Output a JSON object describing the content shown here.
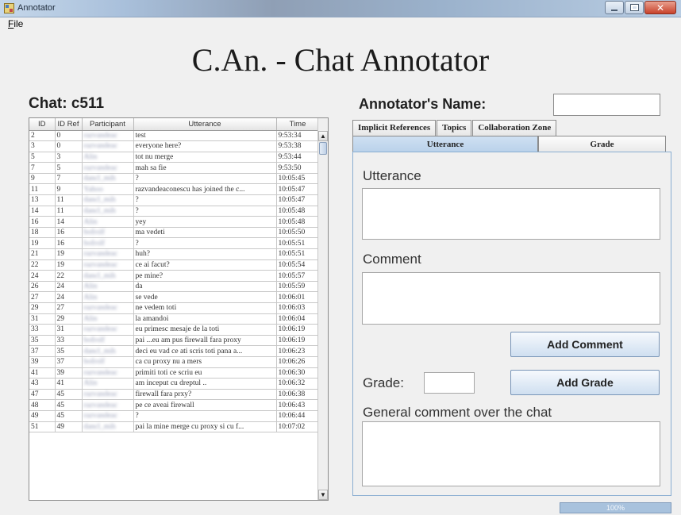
{
  "window": {
    "title": "Annotator",
    "controls": [
      "minimize",
      "maximize",
      "close"
    ]
  },
  "menu": {
    "file_first": "F",
    "file_rest": "ile"
  },
  "app": {
    "title": "C.An. - Chat Annotator"
  },
  "chat": {
    "label": "Chat: c511",
    "columns": [
      "ID",
      "ID Ref",
      "Participant",
      "Utterance",
      "Time"
    ],
    "rows": [
      {
        "id": "2",
        "ref": "0",
        "participant": "razvandeac",
        "utterance": "test",
        "time": "9:53:34"
      },
      {
        "id": "3",
        "ref": "0",
        "participant": "razvandeac",
        "utterance": "everyone here?",
        "time": "9:53:38"
      },
      {
        "id": "5",
        "ref": "3",
        "participant": "Alin",
        "utterance": "tot nu merge",
        "time": "9:53:44"
      },
      {
        "id": "7",
        "ref": "5",
        "participant": "razvandeac",
        "utterance": "mah sa fie",
        "time": "9:53:50"
      },
      {
        "id": "9",
        "ref": "7",
        "participant": "dancl_mih",
        "utterance": "?",
        "time": "10:05:45"
      },
      {
        "id": "11",
        "ref": "9",
        "participant": "Yahoo",
        "utterance": "razvandeaconescu has joined the c...",
        "time": "10:05:47"
      },
      {
        "id": "13",
        "ref": "11",
        "participant": "dancl_mih",
        "utterance": "?",
        "time": "10:05:47"
      },
      {
        "id": "14",
        "ref": "11",
        "participant": "dancl_mih",
        "utterance": "?",
        "time": "10:05:48"
      },
      {
        "id": "16",
        "ref": "14",
        "participant": "Alin",
        "utterance": "yey",
        "time": "10:05:48"
      },
      {
        "id": "18",
        "ref": "16",
        "participant": "bofrolf",
        "utterance": "ma vedeti",
        "time": "10:05:50"
      },
      {
        "id": "19",
        "ref": "16",
        "participant": "bofrolf",
        "utterance": "?",
        "time": "10:05:51"
      },
      {
        "id": "21",
        "ref": "19",
        "participant": "razvandeac",
        "utterance": "huh?",
        "time": "10:05:51"
      },
      {
        "id": "22",
        "ref": "19",
        "participant": "razvandeac",
        "utterance": "ce ai facut?",
        "time": "10:05:54"
      },
      {
        "id": "24",
        "ref": "22",
        "participant": "dancl_mih",
        "utterance": "pe mine?",
        "time": "10:05:57"
      },
      {
        "id": "26",
        "ref": "24",
        "participant": "Alin",
        "utterance": "da",
        "time": "10:05:59"
      },
      {
        "id": "27",
        "ref": "24",
        "participant": "Alin",
        "utterance": "se vede",
        "time": "10:06:01"
      },
      {
        "id": "29",
        "ref": "27",
        "participant": "razvandeac",
        "utterance": "ne vedem toti",
        "time": "10:06:03"
      },
      {
        "id": "31",
        "ref": "29",
        "participant": "Alin",
        "utterance": "la amandoi",
        "time": "10:06:04"
      },
      {
        "id": "33",
        "ref": "31",
        "participant": "razvandeac",
        "utterance": "eu primesc mesaje de la toti",
        "time": "10:06:19"
      },
      {
        "id": "35",
        "ref": "33",
        "participant": "bofrolf",
        "utterance": "pai ...eu am pus firewall fara proxy",
        "time": "10:06:19"
      },
      {
        "id": "37",
        "ref": "35",
        "participant": "dancl_mih",
        "utterance": "deci eu vad ce ati scris toti pana a...",
        "time": "10:06:23"
      },
      {
        "id": "39",
        "ref": "37",
        "participant": "bofrolf",
        "utterance": "ca cu proxy nu a mers",
        "time": "10:06:26"
      },
      {
        "id": "41",
        "ref": "39",
        "participant": "razvandeac",
        "utterance": "primiti toti ce scriu eu",
        "time": "10:06:30"
      },
      {
        "id": "43",
        "ref": "41",
        "participant": "Alin",
        "utterance": "am inceput cu dreptul ..",
        "time": "10:06:32"
      },
      {
        "id": "47",
        "ref": "45",
        "participant": "razvandeac",
        "utterance": "firewall fara prxy?",
        "time": "10:06:38"
      },
      {
        "id": "48",
        "ref": "45",
        "participant": "razvandeac",
        "utterance": "pe ce aveai firewall",
        "time": "10:06:43"
      },
      {
        "id": "49",
        "ref": "45",
        "participant": "razvandeac",
        "utterance": "?",
        "time": "10:06:44"
      },
      {
        "id": "51",
        "ref": "49",
        "participant": "dancl_mih",
        "utterance": "pai la mine merge cu proxy si cu f...",
        "time": "10:07:02"
      }
    ]
  },
  "annotator": {
    "name_label": "Annotator's Name:",
    "name_value": ""
  },
  "tabs": {
    "top": [
      "Implicit References",
      "Topics",
      "Collaboration Zone"
    ],
    "sub": [
      "Utterance",
      "Grade"
    ],
    "active_sub": "Utterance"
  },
  "panel": {
    "utterance_label": "Utterance",
    "utterance_value": "",
    "comment_label": "Comment",
    "comment_value": "",
    "add_comment_label": "Add Comment",
    "grade_label": "Grade:",
    "grade_value": "",
    "add_grade_label": "Add Grade",
    "general_comment_label": "General comment over the chat",
    "general_comment_value": ""
  },
  "status": {
    "progress_text": "100%",
    "progress_fraction": 1.0
  },
  "colors": {
    "active_tab": "#c3d8ee",
    "button_gradient_end": "#cfdff0",
    "progress_bar": "#a8c2dd"
  }
}
